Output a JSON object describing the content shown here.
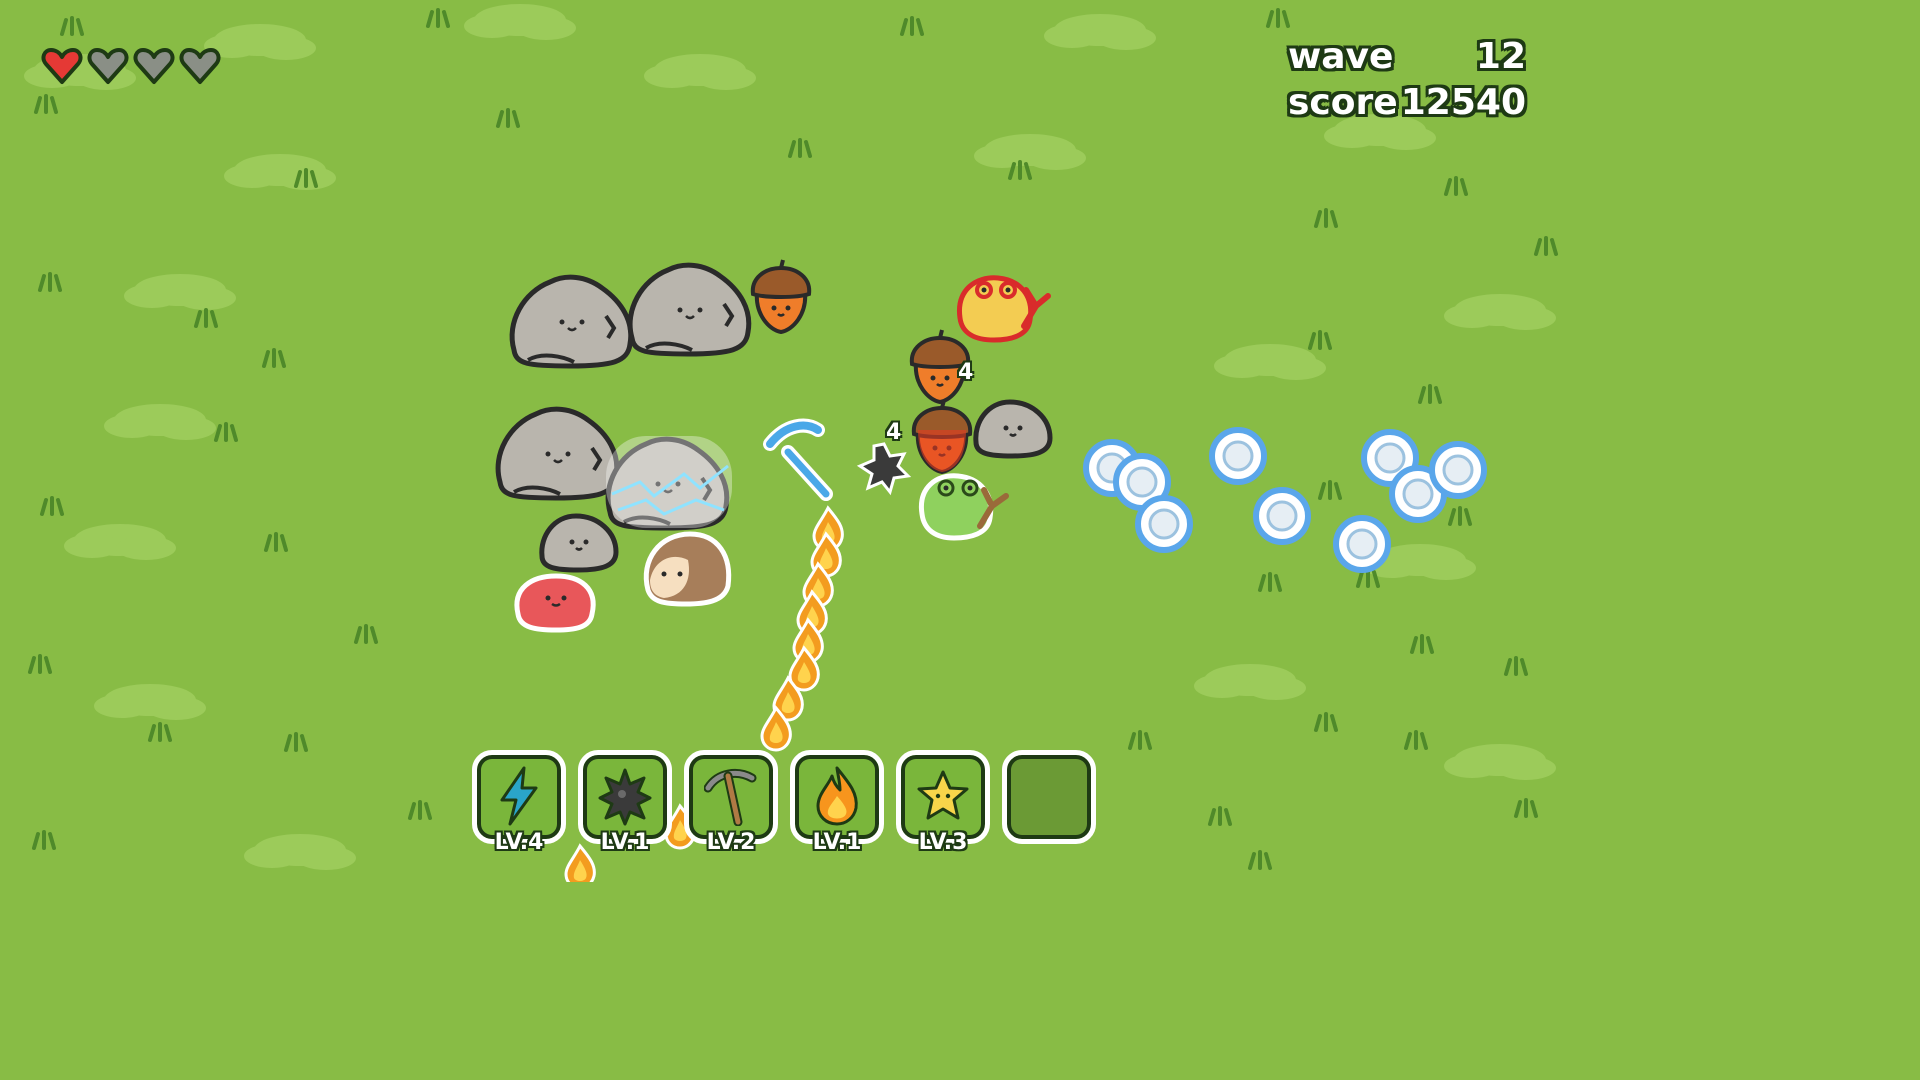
{
  "hud": {
    "wave_label": "wave",
    "wave_value": "12",
    "score_label": "score",
    "score_value": "12540",
    "hearts": [
      {
        "state": "full",
        "color": "#e53935"
      },
      {
        "state": "empty",
        "color": "#8a8f86"
      },
      {
        "state": "empty",
        "color": "#8a8f86"
      },
      {
        "state": "empty",
        "color": "#8a8f86"
      }
    ]
  },
  "skills": [
    {
      "icon": "lightning-icon",
      "level": "LV.4"
    },
    {
      "icon": "spiked-ball-icon",
      "level": "LV.1"
    },
    {
      "icon": "pickaxe-icon",
      "level": "LV.2"
    },
    {
      "icon": "fire-icon",
      "level": "LV.1"
    },
    {
      "icon": "star-icon",
      "level": "LV.3"
    },
    {
      "icon": "",
      "level": ""
    }
  ],
  "damage_numbers": [
    "4",
    "4"
  ],
  "colors": {
    "grass": "#88bc45",
    "outline": "#1e3a14",
    "rock": "#b9b5ad",
    "slime_red": "#e8575a",
    "acorn": "#ef7d2a",
    "frog_green": "#8fd15e",
    "frog_yellow": "#f3cc52",
    "bubble_blue": "#5aa6ea"
  }
}
